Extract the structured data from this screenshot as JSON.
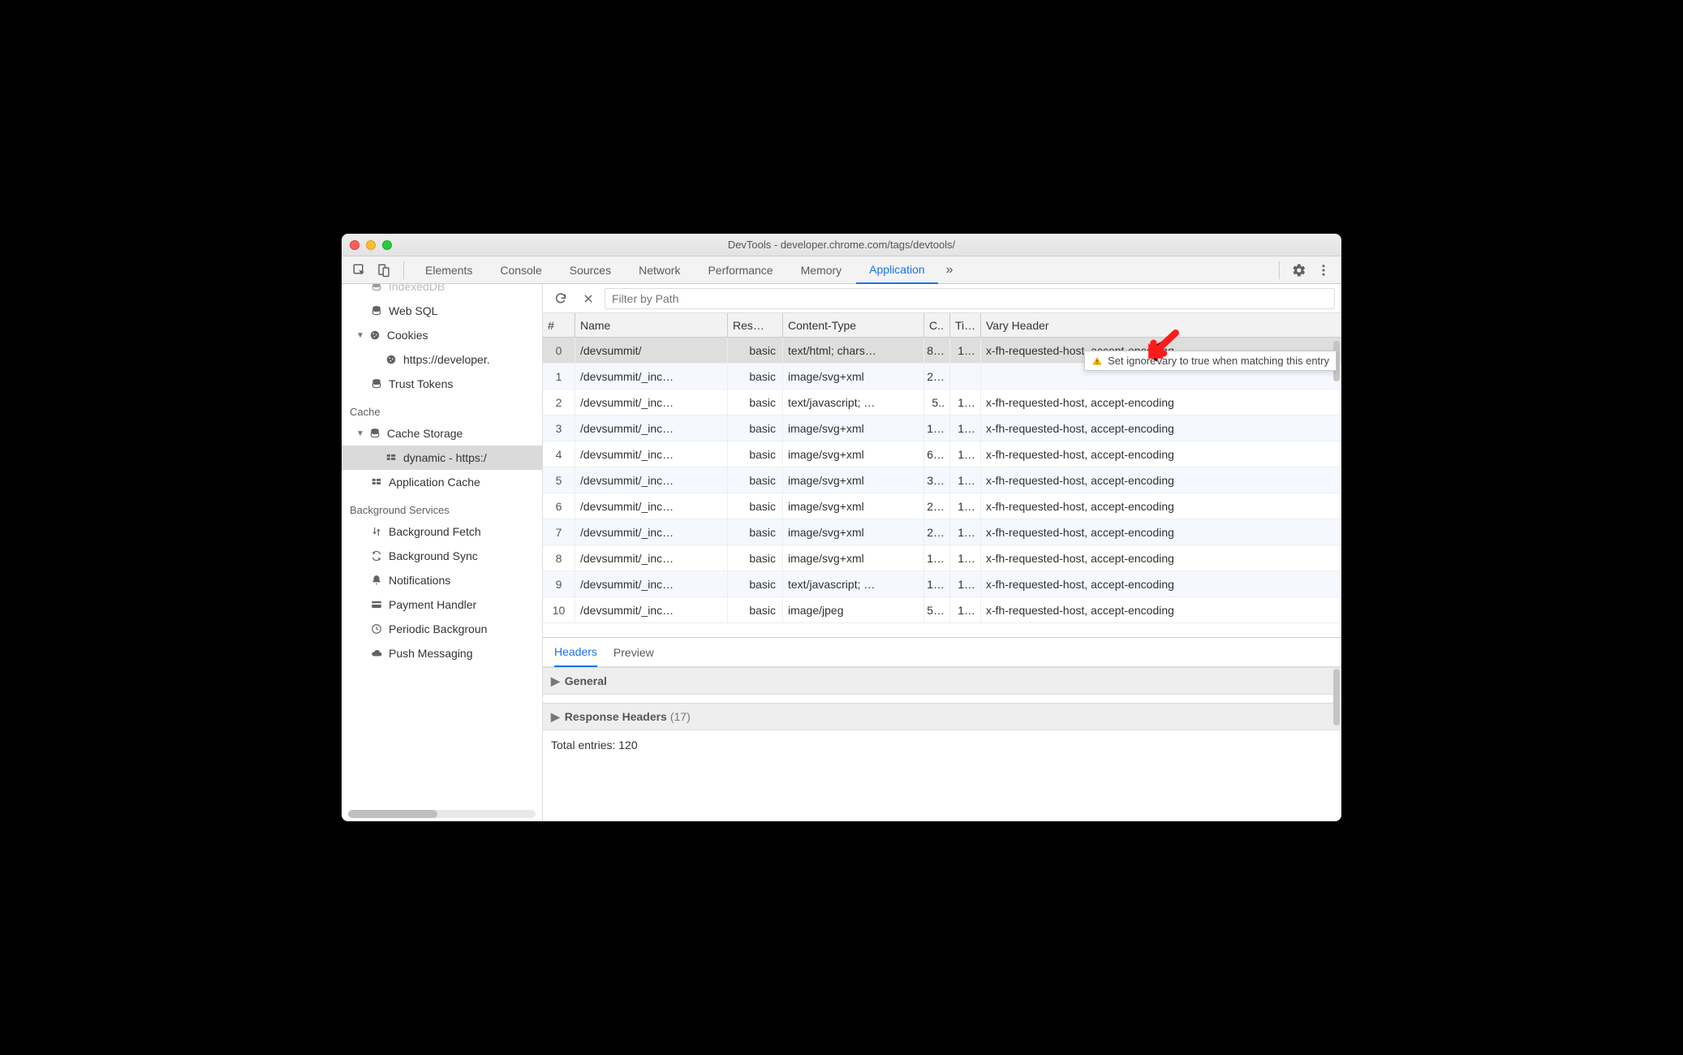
{
  "window": {
    "title": "DevTools - developer.chrome.com/tags/devtools/"
  },
  "tabs": {
    "items": [
      "Elements",
      "Console",
      "Sources",
      "Network",
      "Performance",
      "Memory",
      "Application"
    ],
    "active": "Application",
    "overflow": "»"
  },
  "sidebar": {
    "partial_top": "IndexedDB",
    "web_sql": "Web SQL",
    "cookies": "Cookies",
    "cookies_origin": "https://developer.",
    "trust_tokens": "Trust Tokens",
    "sections": {
      "cache": "Cache",
      "background": "Background Services"
    },
    "cache_storage": "Cache Storage",
    "cache_entry": "dynamic - https:/",
    "application_cache": "Application Cache",
    "bg_fetch": "Background Fetch",
    "bg_sync": "Background Sync",
    "notifications": "Notifications",
    "payment": "Payment Handler",
    "periodic": "Periodic Backgroun",
    "push": "Push Messaging"
  },
  "toolbar": {
    "filter_placeholder": "Filter by Path"
  },
  "table": {
    "headers": {
      "idx": "#",
      "name": "Name",
      "response": "Res…",
      "content_type": "Content-Type",
      "cl": "C..",
      "ti": "Ti…",
      "vary": "Vary Header"
    },
    "rows": [
      {
        "idx": "0",
        "name": "/devsummit/",
        "res": "basic",
        "ct": "text/html; chars…",
        "cl": "8…",
        "ti": "1…",
        "vary": "x-fh-requested-host, accept-encoding",
        "selected": true
      },
      {
        "idx": "1",
        "name": "/devsummit/_inc…",
        "res": "basic",
        "ct": "image/svg+xml",
        "cl": "2…",
        "ti": "",
        "vary": ""
      },
      {
        "idx": "2",
        "name": "/devsummit/_inc…",
        "res": "basic",
        "ct": "text/javascript; …",
        "cl": "5..",
        "ti": "1…",
        "vary": "x-fh-requested-host, accept-encoding"
      },
      {
        "idx": "3",
        "name": "/devsummit/_inc…",
        "res": "basic",
        "ct": "image/svg+xml",
        "cl": "1…",
        "ti": "1…",
        "vary": "x-fh-requested-host, accept-encoding"
      },
      {
        "idx": "4",
        "name": "/devsummit/_inc…",
        "res": "basic",
        "ct": "image/svg+xml",
        "cl": "6…",
        "ti": "1…",
        "vary": "x-fh-requested-host, accept-encoding"
      },
      {
        "idx": "5",
        "name": "/devsummit/_inc…",
        "res": "basic",
        "ct": "image/svg+xml",
        "cl": "3…",
        "ti": "1…",
        "vary": "x-fh-requested-host, accept-encoding"
      },
      {
        "idx": "6",
        "name": "/devsummit/_inc…",
        "res": "basic",
        "ct": "image/svg+xml",
        "cl": "2…",
        "ti": "1…",
        "vary": "x-fh-requested-host, accept-encoding"
      },
      {
        "idx": "7",
        "name": "/devsummit/_inc…",
        "res": "basic",
        "ct": "image/svg+xml",
        "cl": "2…",
        "ti": "1…",
        "vary": "x-fh-requested-host, accept-encoding"
      },
      {
        "idx": "8",
        "name": "/devsummit/_inc…",
        "res": "basic",
        "ct": "image/svg+xml",
        "cl": "1…",
        "ti": "1…",
        "vary": "x-fh-requested-host, accept-encoding"
      },
      {
        "idx": "9",
        "name": "/devsummit/_inc…",
        "res": "basic",
        "ct": "text/javascript; …",
        "cl": "1…",
        "ti": "1…",
        "vary": "x-fh-requested-host, accept-encoding"
      },
      {
        "idx": "10",
        "name": "/devsummit/_inc…",
        "res": "basic",
        "ct": "image/jpeg",
        "cl": "5…",
        "ti": "1…",
        "vary": "x-fh-requested-host, accept-encoding"
      }
    ]
  },
  "tooltip": {
    "text": "Set ignoreVary to true when matching this entry"
  },
  "detail": {
    "tabs": {
      "headers": "Headers",
      "preview": "Preview"
    },
    "general": "General",
    "response_headers": "Response Headers",
    "response_headers_count": "(17)",
    "footer": "Total entries: 120"
  }
}
